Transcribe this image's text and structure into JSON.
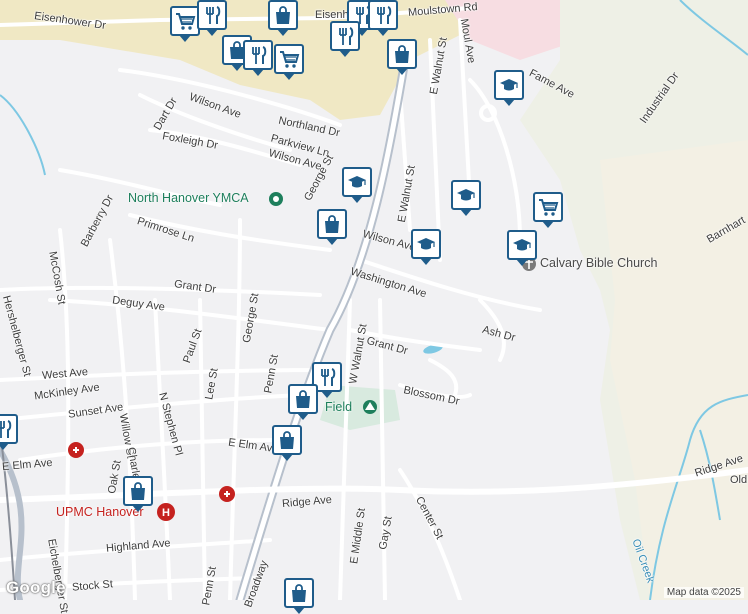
{
  "colors": {
    "water": "#7ec8e3",
    "park": "#d8eadf",
    "retail": "#f0e8c4",
    "road_main": "#b7c0cc",
    "road_minor": "#ffffff",
    "pin_border": "#1f5c8a",
    "poi_green": "#1e7f5c",
    "hospital_red": "#c5221f"
  },
  "streets": [
    "Eisenhower Dr",
    "Eisenhower Dr",
    "Moulstown Rd",
    "Moul Ave",
    "E Walnut St",
    "Fame Ave",
    "Industrial Dr",
    "Dart Dr",
    "Wilson Ave",
    "Foxleigh Dr",
    "Northland Dr",
    "Parkview Ln",
    "Wilson Ave",
    "George St",
    "E Walnut St",
    "Barnhart",
    "Barberry Dr",
    "Primrose Ln",
    "Wilson Ave",
    "Washington Ave",
    "McCosh St",
    "Grant Dr",
    "Deguy Ave",
    "Paul St",
    "George St",
    "Grant Dr",
    "Ash Dr",
    "W Walnut St",
    "Hershelberger St",
    "West Ave",
    "McKinley Ave",
    "Lee St",
    "Penn St",
    "Blossom Dr",
    "Sunset Ave",
    "N Stephen Pl",
    "Willow St",
    "E Elm Ave",
    "E Elm Ave",
    "Charles",
    "Oak St",
    "Ridge Ave",
    "Ridge Ave",
    "Old",
    "Center St",
    "Highland Ave",
    "E Middle St",
    "Gay St",
    "Eichelberger St",
    "Stock St",
    "Penn St",
    "Broadway",
    "Oil Creek"
  ],
  "pois": {
    "ymca": "North Hanover YMCA",
    "church": "Calvary Bible Church",
    "hospital": "UPMC Hanover",
    "field": "Field"
  },
  "pins": [
    {
      "type": "shopping-cart"
    },
    {
      "type": "restaurant"
    },
    {
      "type": "shopping-bag"
    },
    {
      "type": "restaurant"
    },
    {
      "type": "restaurant"
    },
    {
      "type": "shopping-bag"
    },
    {
      "type": "restaurant"
    },
    {
      "type": "shopping-cart"
    },
    {
      "type": "restaurant"
    },
    {
      "type": "shopping-bag"
    },
    {
      "type": "school"
    },
    {
      "type": "school"
    },
    {
      "type": "shopping-bag"
    },
    {
      "type": "school"
    },
    {
      "type": "shopping-cart"
    },
    {
      "type": "school"
    },
    {
      "type": "school"
    },
    {
      "type": "restaurant"
    },
    {
      "type": "shopping-bag"
    },
    {
      "type": "shopping-bag"
    },
    {
      "type": "shopping-bag"
    },
    {
      "type": "shopping-bag"
    },
    {
      "type": "restaurant"
    }
  ],
  "footer": {
    "logo": "Google",
    "credit": "Map data ©2025"
  }
}
